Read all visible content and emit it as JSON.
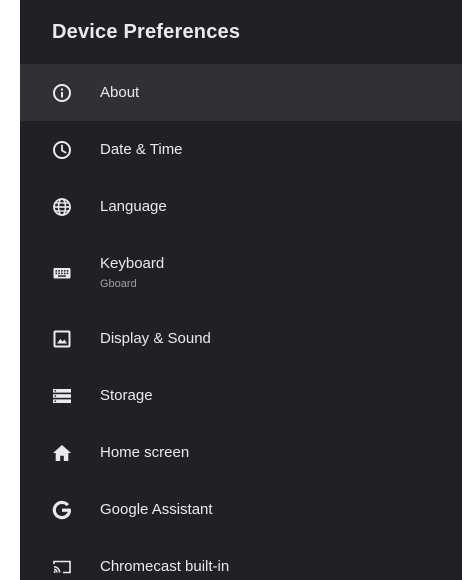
{
  "header": {
    "title": "Device Preferences"
  },
  "menu": {
    "items": [
      {
        "label": "About",
        "icon": "info-icon",
        "selected": true
      },
      {
        "label": "Date & Time",
        "icon": "clock-icon"
      },
      {
        "label": "Language",
        "icon": "globe-icon"
      },
      {
        "label": "Keyboard",
        "sublabel": "Gboard",
        "icon": "keyboard-icon"
      },
      {
        "label": "Display & Sound",
        "icon": "display-icon"
      },
      {
        "label": "Storage",
        "icon": "storage-icon"
      },
      {
        "label": "Home screen",
        "icon": "home-icon"
      },
      {
        "label": "Google Assistant",
        "icon": "google-icon"
      },
      {
        "label": "Chromecast built-in",
        "icon": "cast-icon"
      }
    ]
  },
  "colors": {
    "panel_background": "#202124",
    "selected_background": "#303134",
    "text_primary": "#e8eaed",
    "text_secondary": "#9aa0a6"
  }
}
